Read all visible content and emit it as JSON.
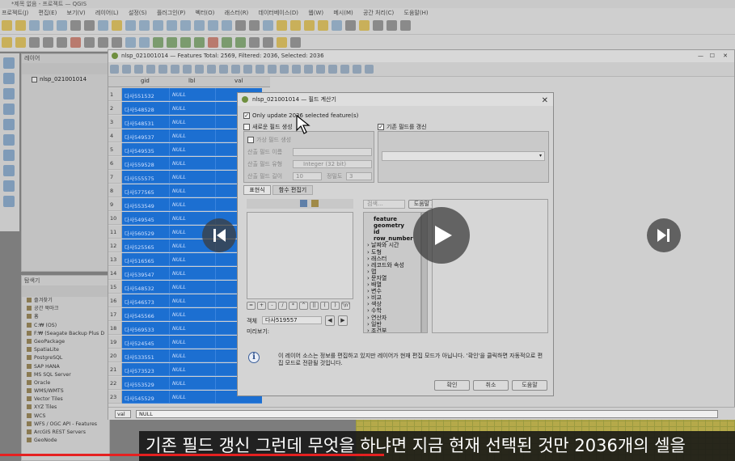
{
  "window": {
    "title": "*제목 없음 - 프로젝트 — QGIS"
  },
  "menu": [
    "프로젝트(J)",
    "편집(E)",
    "보기(V)",
    "레이어(L)",
    "설정(S)",
    "플러그인(P)",
    "벡터(O)",
    "래스터(R)",
    "데이터베이스(D)",
    "웹(W)",
    "메시(M)",
    "공간 처리(C)",
    "도움말(H)"
  ],
  "layers_panel": {
    "title": "레이어",
    "items": [
      {
        "label": "nlsp_021001014",
        "checked": true
      }
    ]
  },
  "browser_panel": {
    "title": "탐색기",
    "items": [
      "즐겨찾기",
      "공간 북마크",
      "홈",
      "C:₩ (OS)",
      "F:₩ (Seagate Backup Plus D",
      "GeoPackage",
      "SpatiaLite",
      "PostgreSQL",
      "SAP HANA",
      "MS SQL Server",
      "Oracle",
      "WMS/WMTS",
      "Vector Tiles",
      "XYZ Tiles",
      "WCS",
      "WFS / OGC API - Features",
      "ArcGIS REST Servers",
      "GeoNode"
    ]
  },
  "attribute_table": {
    "title": "nlsp_021001014 — Features Total: 2569, Filtered: 2036, Selected: 2036",
    "columns": [
      "gid",
      "lbl",
      "val"
    ],
    "rows": [
      {
        "n": "1",
        "gid": "다사551532",
        "lbl": "NULL"
      },
      {
        "n": "2",
        "gid": "다사548528",
        "lbl": "NULL"
      },
      {
        "n": "3",
        "gid": "다사548531",
        "lbl": "NULL"
      },
      {
        "n": "4",
        "gid": "다사549537",
        "lbl": "NULL"
      },
      {
        "n": "5",
        "gid": "다사549535",
        "lbl": "NULL"
      },
      {
        "n": "6",
        "gid": "다사559528",
        "lbl": "NULL"
      },
      {
        "n": "7",
        "gid": "다사555575",
        "lbl": "NULL"
      },
      {
        "n": "8",
        "gid": "다사577565",
        "lbl": "NULL"
      },
      {
        "n": "9",
        "gid": "다사553549",
        "lbl": "NULL"
      },
      {
        "n": "10",
        "gid": "다사549545",
        "lbl": "NULL"
      },
      {
        "n": "11",
        "gid": "다사560529",
        "lbl": "NULL"
      },
      {
        "n": "12",
        "gid": "다사525565",
        "lbl": "NULL"
      },
      {
        "n": "13",
        "gid": "다사516565",
        "lbl": "NULL"
      },
      {
        "n": "14",
        "gid": "다사539547",
        "lbl": "NULL"
      },
      {
        "n": "15",
        "gid": "다사548532",
        "lbl": "NULL"
      },
      {
        "n": "16",
        "gid": "다사546573",
        "lbl": "NULL"
      },
      {
        "n": "17",
        "gid": "다사545566",
        "lbl": "NULL"
      },
      {
        "n": "18",
        "gid": "다사569533",
        "lbl": "NULL"
      },
      {
        "n": "19",
        "gid": "다사524545",
        "lbl": "NULL"
      },
      {
        "n": "20",
        "gid": "다사533551",
        "lbl": "NULL"
      },
      {
        "n": "21",
        "gid": "다사573523",
        "lbl": "NULL"
      },
      {
        "n": "22",
        "gid": "다사553529",
        "lbl": "NULL"
      },
      {
        "n": "23",
        "gid": "다사545529",
        "lbl": "NULL"
      }
    ],
    "expr_field": "val",
    "expr_value": "NULL"
  },
  "dialog": {
    "title": "nlsp_021001014 — 필드 계산기",
    "only_update": "Only update 2036 selected feature(s)",
    "new_field": "새로운 필드 생성",
    "virtual_field": "가상 필드 생성",
    "output_name_label": "산출 필드 이름",
    "output_type_label": "산출 필드 유형",
    "output_type_value": "Integer (32 bit)",
    "output_length_label": "산출 필드 길이",
    "output_length_value": "10",
    "precision_label": "정밀도",
    "precision_value": "3",
    "update_existing": "기존 필드를 갱신",
    "tab_expression": "표현식",
    "tab_function_editor": "함수 편집기",
    "search_placeholder": "검색...",
    "help_button": "도움말 보기",
    "functions": [
      {
        "label": "feature",
        "bold": true
      },
      {
        "label": "geometry",
        "bold": true
      },
      {
        "label": "id",
        "bold": true
      },
      {
        "label": "row_number",
        "bold": true
      },
      {
        "label": "날짜와 시간",
        "bold": false
      },
      {
        "label": "도형",
        "bold": false
      },
      {
        "label": "래스터",
        "bold": false
      },
      {
        "label": "레코드와 속성",
        "bold": false
      },
      {
        "label": "맵",
        "bold": false
      },
      {
        "label": "문자열",
        "bold": false
      },
      {
        "label": "배열",
        "bold": false
      },
      {
        "label": "변수",
        "bold": false
      },
      {
        "label": "비교",
        "bold": false
      },
      {
        "label": "색상",
        "bold": false
      },
      {
        "label": "수학",
        "bold": false
      },
      {
        "label": "연산자",
        "bold": false
      },
      {
        "label": "일반",
        "bold": false
      },
      {
        "label": "조건부",
        "bold": false
      }
    ],
    "operators": [
      "=",
      "+",
      "-",
      "/",
      "*",
      "^",
      "||",
      "(",
      ")",
      "'\\n'"
    ],
    "feature_label": "객체",
    "feature_value": "다사519557",
    "preview_label": "미리보기:",
    "info": "이 레이어 소스는 정보를 편집하고 있지만 레이어가 현재 편집 모드가 아닙니다. '확인'을 클릭하면 자동적으로 편집 모드로 전환될 것입니다.",
    "ok": "확인",
    "cancel": "취소",
    "help": "도움말"
  },
  "subtitle": "기존 필드 갱신 그런데 무엇을 하냐면 지금 현재 선택된 것만 2036개의 셀을"
}
